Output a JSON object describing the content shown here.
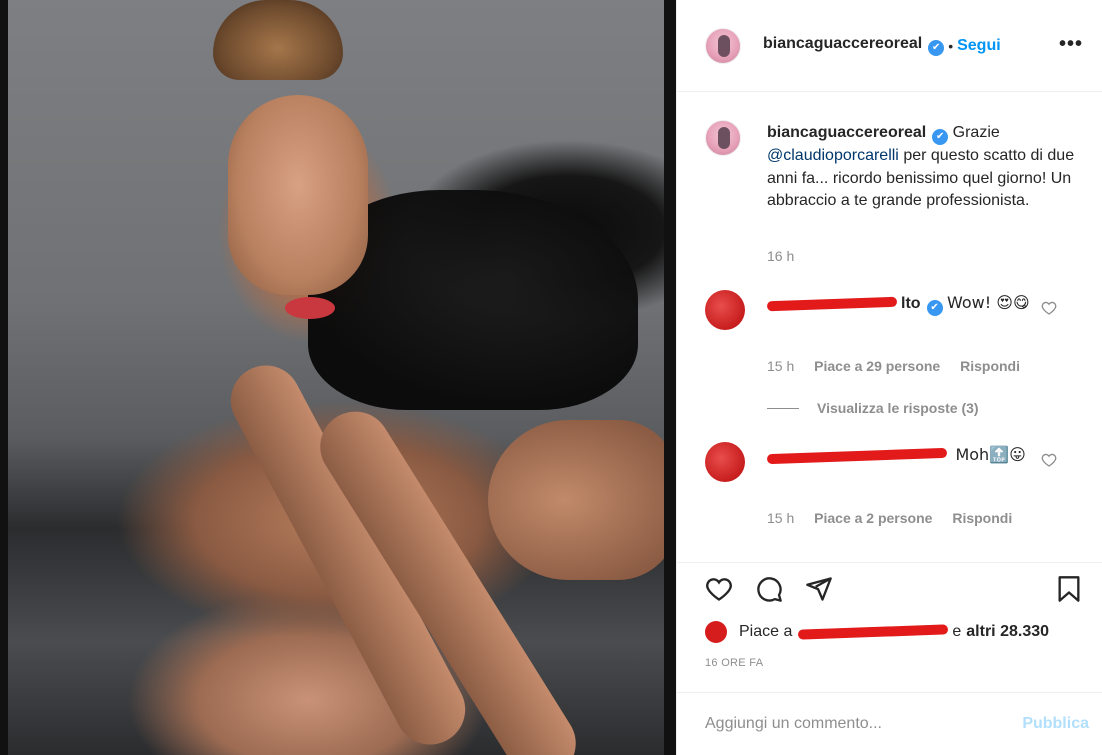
{
  "post": {
    "username": "biancaguaccereoreal",
    "follow_label": "Segui",
    "more_label": "•••",
    "verified_mark": "✔"
  },
  "caption": {
    "username": "biancaguaccereoreal",
    "text_before_mention": "Grazie",
    "mention": "@claudioporcarelli",
    "text_after_mention": "per questo scatto di due anni fa... ricordo benissimo quel giorno! Un abbraccio a te grande professionista.",
    "time": "16 h"
  },
  "comments": [
    {
      "username_visible_suffix": "lto",
      "text": "Wow! 😍😋",
      "time": "15 h",
      "likes": "Piace a 29 persone",
      "reply_label": "Rispondi"
    },
    {
      "text": "Moh🔝😛",
      "time": "15 h",
      "likes": "Piace a 2 persone",
      "reply_label": "Rispondi"
    }
  ],
  "replies_label": "Visualizza le risposte (3)",
  "likes": {
    "prefix": "Piace a",
    "suffix": "e",
    "others": "altri 28.330"
  },
  "posted_time": "16 ORE FA",
  "comment_box": {
    "placeholder": "Aggiungi un commento...",
    "publish_label": "Pubblica"
  },
  "icons": [
    "heart-icon",
    "comment-icon",
    "share-icon",
    "bookmark-icon",
    "more-icon",
    "verified-icon"
  ],
  "colors": {
    "accent": "#0095f6",
    "verified": "#3897f0",
    "publish_disabled": "#b2dffc",
    "redaction": "#e21a1a"
  }
}
